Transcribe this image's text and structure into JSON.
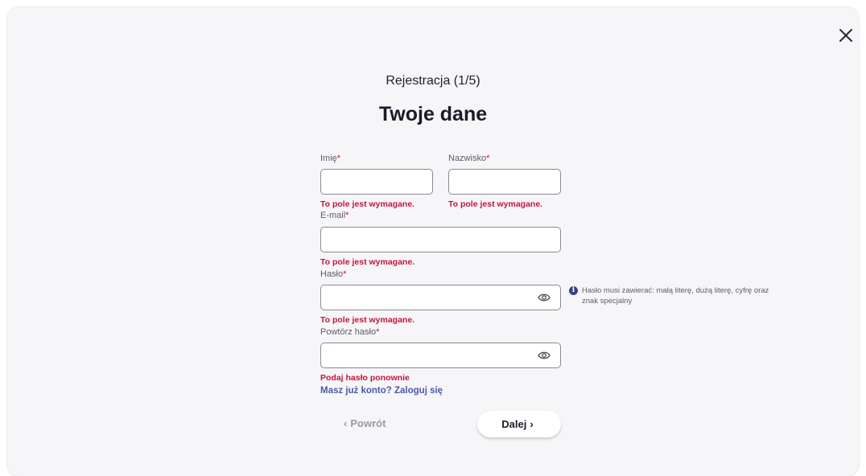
{
  "header": {
    "step": "Rejestracja (1/5)",
    "title": "Twoje dane"
  },
  "required_mark": "*",
  "fields": {
    "first_name": {
      "label": "Imię",
      "value": "",
      "error": "To pole jest wymagane."
    },
    "last_name": {
      "label": "Nazwisko",
      "value": "",
      "error": "To pole jest wymagane."
    },
    "email": {
      "label": "E-mail",
      "value": "",
      "error": "To pole jest wymagane."
    },
    "password": {
      "label": "Hasło",
      "value": "",
      "error": "To pole jest wymagane."
    },
    "repeat_password": {
      "label": "Powtórz hasło",
      "value": "",
      "error": "Podaj hasło ponownie"
    }
  },
  "password_hint": "Hasło musi zawierać: małą literę, dużą literę, cyfrę oraz znak specjalny",
  "login_link": "Masz już konto? Zaloguj się",
  "buttons": {
    "back": "Powrót",
    "next": "Dalej"
  },
  "icons": {
    "close": "close-icon",
    "eye": "eye-icon",
    "info": "info-icon",
    "chevron_left": "chevron-left-icon",
    "chevron_right": "chevron-right-icon"
  },
  "colors": {
    "error": "#c4143c",
    "link": "#4b5aa6",
    "info": "#3b3f8c",
    "modal_bg": "#f6f6f8"
  }
}
